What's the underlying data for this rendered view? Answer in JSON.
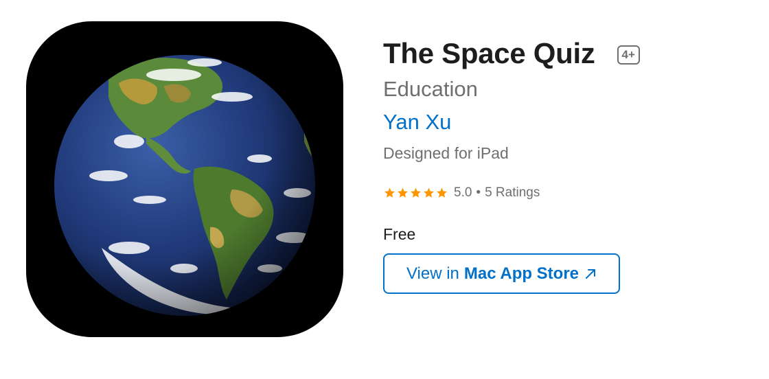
{
  "app": {
    "icon_name": "earth-globe-icon",
    "title": "The Space Quiz",
    "age_rating": "4+",
    "category": "Education",
    "developer": "Yan Xu",
    "designed_for": "Designed for iPad",
    "rating": {
      "stars": 5,
      "max_stars": 5,
      "value": "5.0",
      "separator": "•",
      "count": "5 Ratings"
    },
    "price": "Free"
  },
  "button": {
    "label_prefix": "View in",
    "label_store": "Mac App Store",
    "icon_name": "external-arrow-icon"
  },
  "colors": {
    "link": "#0070c9",
    "star": "#ff9500",
    "secondary_text": "#6e6e73",
    "icon_background": "#000000"
  }
}
